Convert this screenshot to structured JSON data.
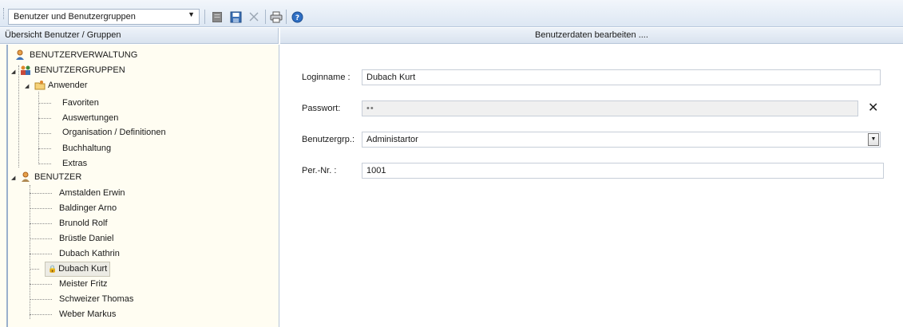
{
  "toolbar": {
    "combo_value": "Benutzer und Benutzergruppen",
    "icons": [
      "new-document-icon",
      "save-icon",
      "delete-icon",
      "print-icon",
      "help-icon"
    ]
  },
  "left_header": "Übersicht Benutzer / Gruppen",
  "right_header": "Benutzerdaten bearbeiten ....",
  "tree": {
    "root": "BENUTZERVERWALTUNG",
    "groups_label": "BENUTZERGRUPPEN",
    "group_anwender": "Anwender",
    "group_items": [
      "Favoriten",
      "Auswertungen",
      "Organisation / Definitionen",
      "Buchhaltung",
      "Extras"
    ],
    "users_label": "BENUTZER",
    "users": [
      "Amstalden Erwin",
      "Baldinger Arno",
      "Brunold Rolf",
      "Brüstle Daniel",
      "Dubach Kathrin",
      "Dubach Kurt",
      "Meister Fritz",
      "Schweizer Thomas",
      "Weber Markus"
    ],
    "selected_user": "Dubach Kurt"
  },
  "form": {
    "login_label": "Loginname :",
    "login_value": "Dubach Kurt",
    "password_label": "Passwort:",
    "password_value": "••",
    "group_label": "Benutzergrp.:",
    "group_value": "Administartor",
    "pernr_label": "Per.-Nr. :",
    "pernr_value": "1001",
    "clear_symbol": "✕"
  },
  "colors": {
    "tree_background": "#fffdf2",
    "toolbar_gradient_top": "#f2f6fb",
    "header_gradient_bottom": "#d9e3ef"
  }
}
